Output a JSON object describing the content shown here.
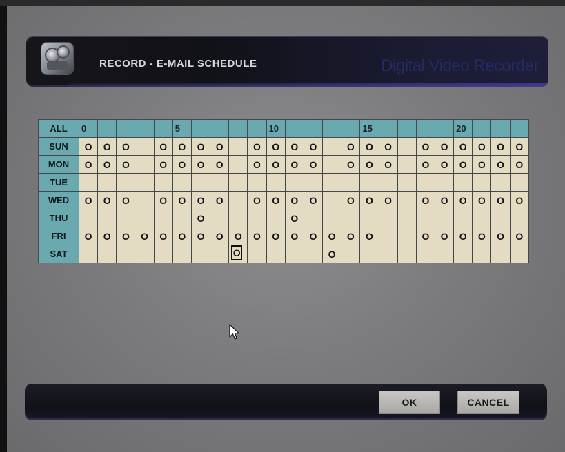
{
  "header": {
    "title": "RECORD - E-MAIL SCHEDULE",
    "brand": "Digital Video Recorder",
    "icon": "camera-icon"
  },
  "schedule": {
    "all_label": "ALL",
    "hour_markers": [
      "0",
      "",
      "",
      "",
      "",
      "5",
      "",
      "",
      "",
      "",
      "10",
      "",
      "",
      "",
      "",
      "15",
      "",
      "",
      "",
      "",
      "20",
      "",
      "",
      ""
    ],
    "mark": "O",
    "days": [
      {
        "label": "SUN",
        "slots": [
          1,
          1,
          1,
          0,
          1,
          1,
          1,
          1,
          0,
          1,
          1,
          1,
          1,
          0,
          1,
          1,
          1,
          0,
          1,
          1,
          1,
          1,
          1,
          1
        ]
      },
      {
        "label": "MON",
        "slots": [
          1,
          1,
          1,
          0,
          1,
          1,
          1,
          1,
          0,
          1,
          1,
          1,
          1,
          0,
          1,
          1,
          1,
          0,
          1,
          1,
          1,
          1,
          1,
          1
        ]
      },
      {
        "label": "TUE",
        "slots": [
          0,
          0,
          0,
          0,
          0,
          0,
          0,
          0,
          0,
          0,
          0,
          0,
          0,
          0,
          0,
          0,
          0,
          0,
          0,
          0,
          0,
          0,
          0,
          0
        ]
      },
      {
        "label": "WED",
        "slots": [
          1,
          1,
          1,
          0,
          1,
          1,
          1,
          1,
          0,
          1,
          1,
          1,
          1,
          0,
          1,
          1,
          1,
          0,
          1,
          1,
          1,
          1,
          1,
          1
        ]
      },
      {
        "label": "THU",
        "slots": [
          0,
          0,
          0,
          0,
          0,
          0,
          1,
          0,
          0,
          0,
          0,
          1,
          0,
          0,
          0,
          0,
          0,
          0,
          0,
          0,
          0,
          0,
          0,
          0
        ]
      },
      {
        "label": "FRI",
        "slots": [
          1,
          1,
          1,
          1,
          1,
          1,
          1,
          1,
          1,
          1,
          1,
          1,
          1,
          1,
          1,
          1,
          0,
          0,
          1,
          1,
          1,
          1,
          1,
          1
        ]
      },
      {
        "label": "SAT",
        "slots": [
          0,
          0,
          0,
          0,
          0,
          0,
          0,
          0,
          1,
          0,
          0,
          0,
          0,
          1,
          0,
          0,
          0,
          0,
          0,
          0,
          0,
          0,
          0,
          0
        ]
      }
    ],
    "selected": {
      "day": "SAT",
      "hour": 8
    }
  },
  "buttons": {
    "ok": "OK",
    "cancel": "CANCEL"
  },
  "colors": {
    "header_bg": "#111118",
    "grid_header": "#6aa9b0",
    "grid_cell": "#e3dcc3",
    "brand_text": "#262a66"
  }
}
